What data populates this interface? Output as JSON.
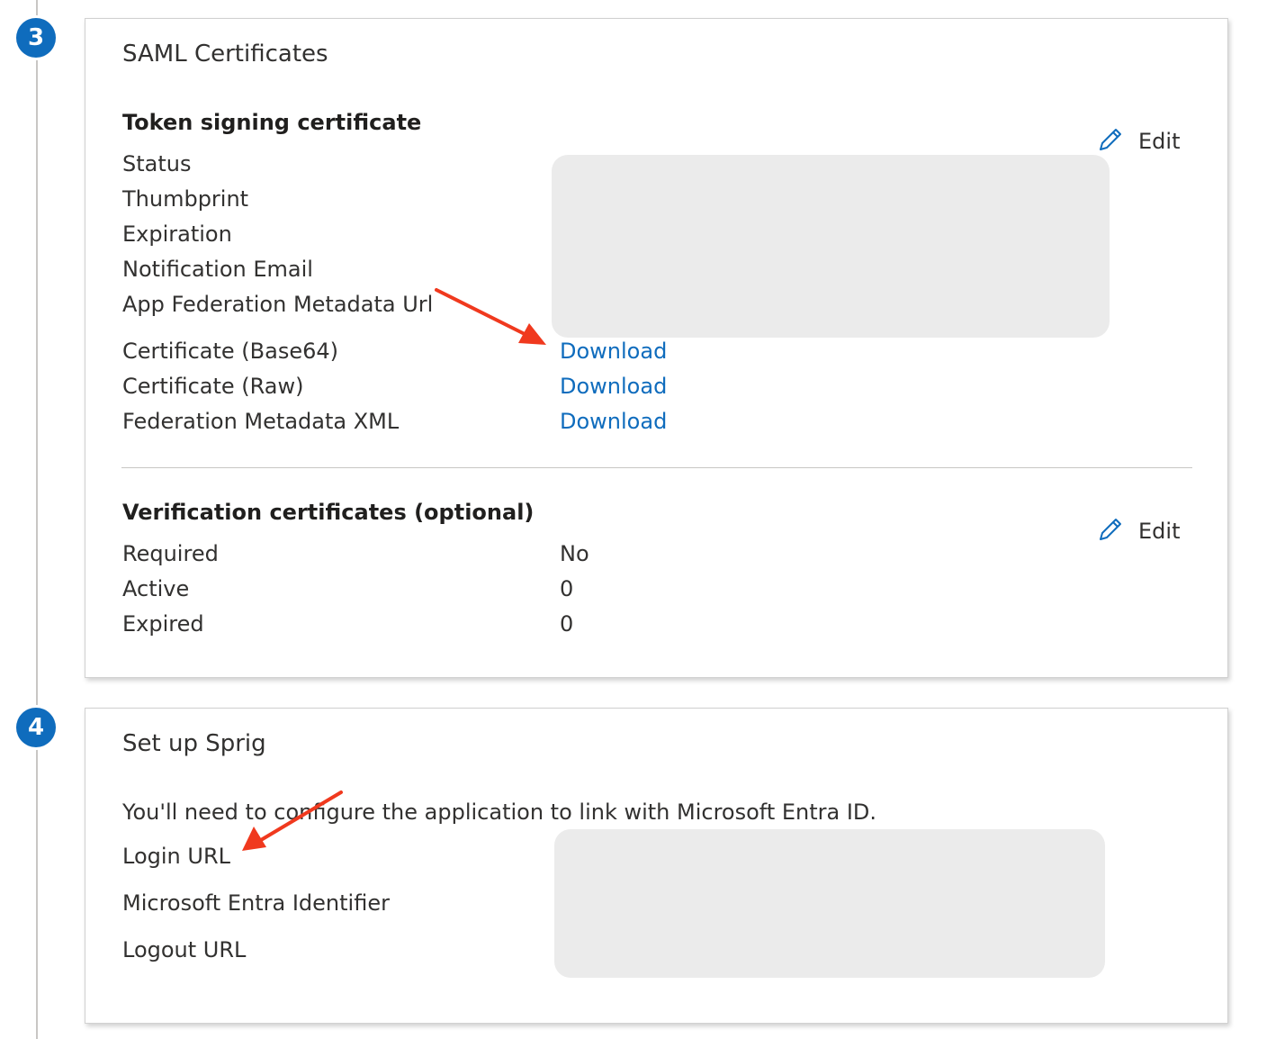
{
  "steps": [
    {
      "number": "3"
    },
    {
      "number": "4"
    }
  ],
  "saml_card": {
    "title": "SAML Certificates",
    "token_section": {
      "title": "Token signing certificate",
      "edit_label": "Edit",
      "rows": [
        {
          "label": "Status"
        },
        {
          "label": "Thumbprint"
        },
        {
          "label": "Expiration"
        },
        {
          "label": "Notification Email"
        },
        {
          "label": "App Federation Metadata Url"
        },
        {
          "label": "Certificate (Base64)",
          "link": "Download"
        },
        {
          "label": "Certificate (Raw)",
          "link": "Download"
        },
        {
          "label": "Federation Metadata XML",
          "link": "Download"
        }
      ]
    },
    "verification_section": {
      "title": "Verification certificates (optional)",
      "edit_label": "Edit",
      "rows": [
        {
          "label": "Required",
          "value": "No"
        },
        {
          "label": "Active",
          "value": "0"
        },
        {
          "label": "Expired",
          "value": "0"
        }
      ]
    }
  },
  "setup_card": {
    "title": "Set up Sprig",
    "description": "You'll need to configure the application to link with Microsoft Entra ID.",
    "rows": [
      {
        "label": "Login URL"
      },
      {
        "label": "Microsoft Entra Identifier"
      },
      {
        "label": "Logout URL"
      }
    ]
  },
  "colors": {
    "accent": "#0f6cbd",
    "annotation_arrow": "#f0391e",
    "redaction": "#ebebeb"
  },
  "icons": {
    "edit": "pencil-icon"
  }
}
